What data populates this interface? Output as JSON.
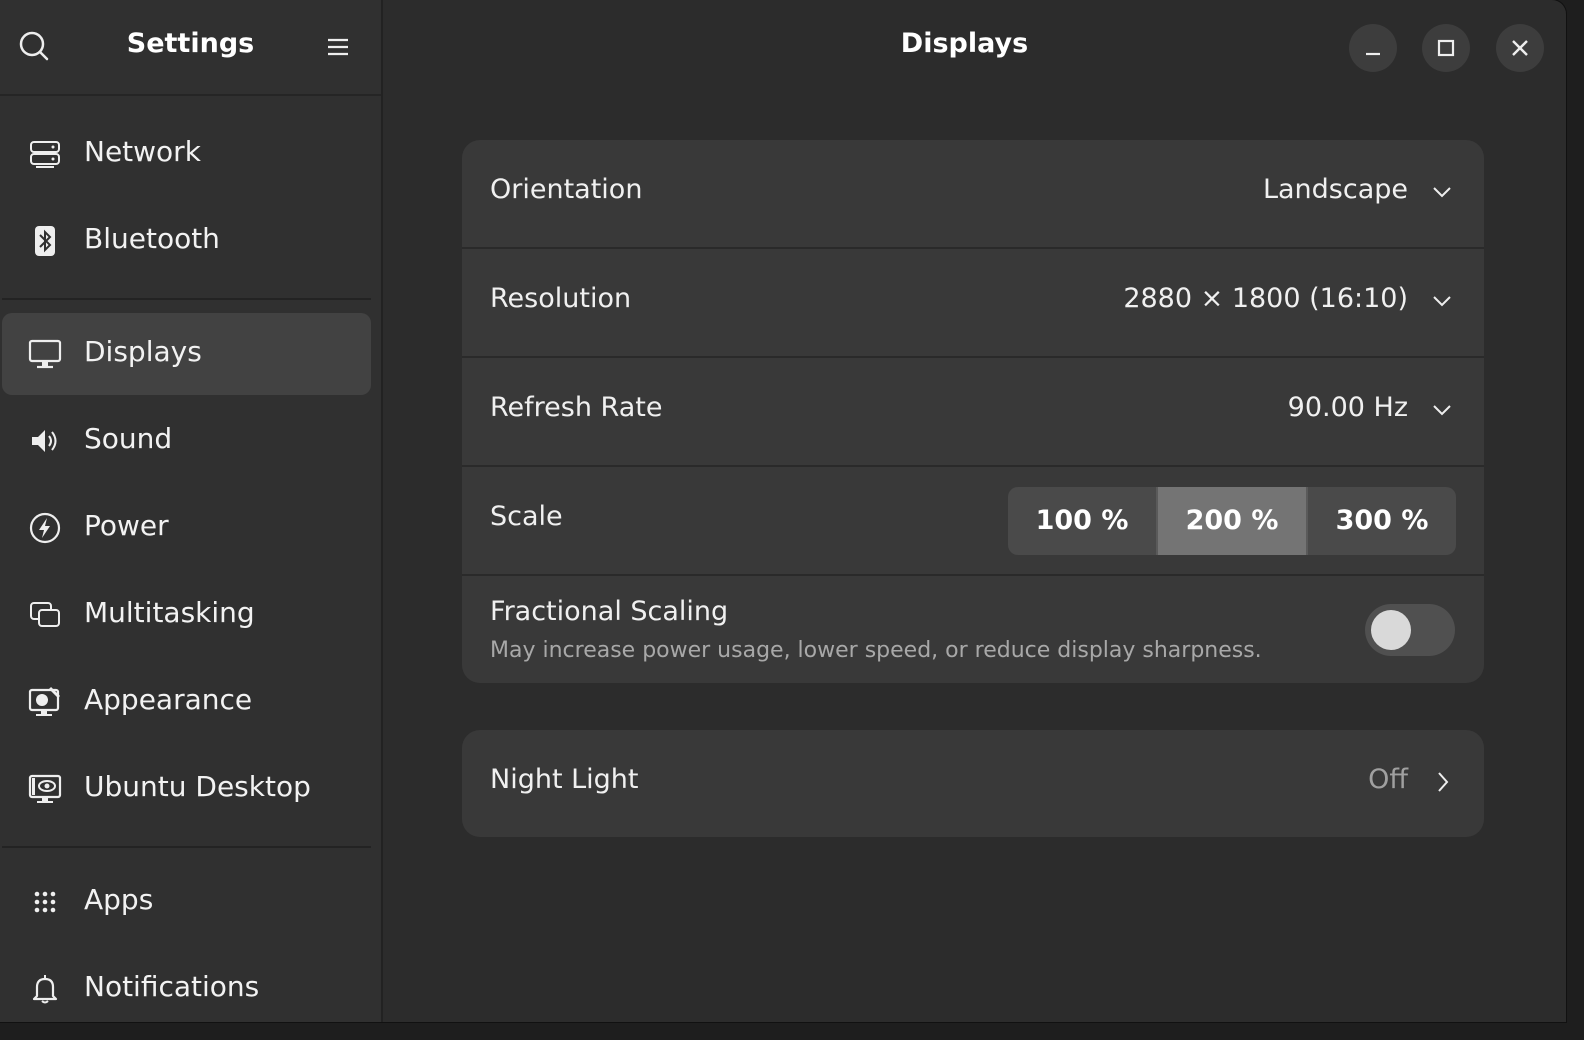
{
  "sidebar": {
    "title": "Settings",
    "search_icon": "search-icon",
    "menu_icon": "hamburger-menu-icon",
    "items": [
      {
        "label": "Network",
        "icon": "network-icon"
      },
      {
        "label": "Bluetooth",
        "icon": "bluetooth-icon"
      },
      {
        "label": "Displays",
        "icon": "display-icon",
        "active": true
      },
      {
        "label": "Sound",
        "icon": "speaker-icon"
      },
      {
        "label": "Power",
        "icon": "power-icon"
      },
      {
        "label": "Multitasking",
        "icon": "multitasking-icon"
      },
      {
        "label": "Appearance",
        "icon": "appearance-icon"
      },
      {
        "label": "Ubuntu Desktop",
        "icon": "ubuntu-desktop-icon"
      },
      {
        "label": "Apps",
        "icon": "apps-grid-icon"
      },
      {
        "label": "Notifications",
        "icon": "bell-icon"
      }
    ]
  },
  "header": {
    "title": "Displays",
    "buttons": [
      "minimize-icon",
      "maximize-icon",
      "close-icon"
    ]
  },
  "display_settings": {
    "orientation": {
      "label": "Orientation",
      "value": "Landscape"
    },
    "resolution": {
      "label": "Resolution",
      "value": "2880 × 1800 (16:10)"
    },
    "refresh_rate": {
      "label": "Refresh Rate",
      "value": "90.00 Hz"
    },
    "scale": {
      "label": "Scale",
      "options": [
        "100 %",
        "200 %",
        "300 %"
      ],
      "selected": "200 %"
    },
    "fractional_scaling": {
      "label": "Fractional Scaling",
      "description": "May increase power usage, lower speed, or reduce display sharpness.",
      "enabled": false
    }
  },
  "night_light": {
    "label": "Night Light",
    "value": "Off"
  },
  "colors": {
    "window_bg": "#2c2c2c",
    "sidebar_bg": "#303030",
    "card_bg": "#393939",
    "active_item_bg": "#424242",
    "scale_selected_bg": "#747474"
  }
}
